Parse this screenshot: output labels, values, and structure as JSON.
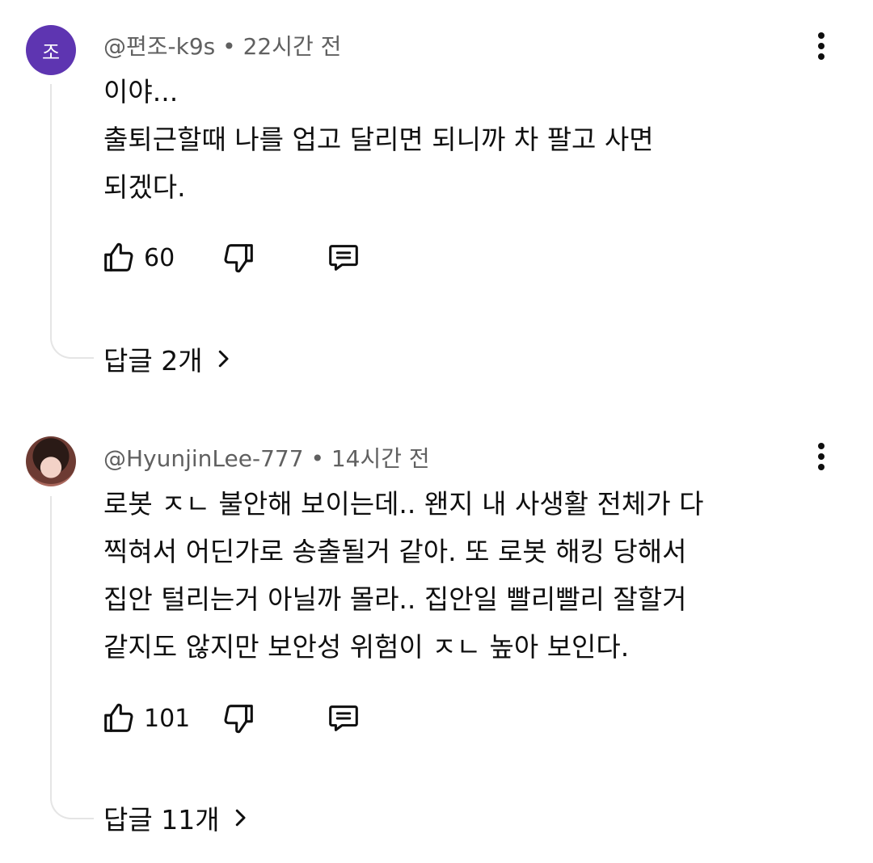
{
  "comments": [
    {
      "avatar_letter": "조",
      "avatar_color": "#5e35b1",
      "author": "@편조-k9s",
      "time": "22시간 전",
      "body_lines": [
        "이야...",
        "출퇴근할때 나를 업고 달리면 되니까 차 팔고 사면",
        "되겠다."
      ],
      "likes": "60",
      "replies_label": "답글 2개"
    },
    {
      "avatar_icon": "profile-photo",
      "author": "@HyunjinLee-777",
      "time": "14시간 전",
      "body_lines": [
        "로봇 ㅈㄴ 불안해 보이는데.. 왠지 내 사생활 전체가 다",
        "찍혀서 어딘가로 송출될거 같아. 또 로봇 해킹 당해서",
        "집안 털리는거 아닐까 몰라.. 집안일 빨리빨리 잘할거",
        "같지도 않지만 보안성 위험이 ㅈㄴ 높아 보인다."
      ],
      "likes": "101",
      "replies_label": "답글 11개"
    }
  ],
  "separator": "•",
  "icons": {
    "like": "thumbs-up-icon",
    "dislike": "thumbs-down-icon",
    "reply": "comment-icon",
    "more": "more-vertical-icon",
    "chevron": "chevron-right-icon"
  }
}
